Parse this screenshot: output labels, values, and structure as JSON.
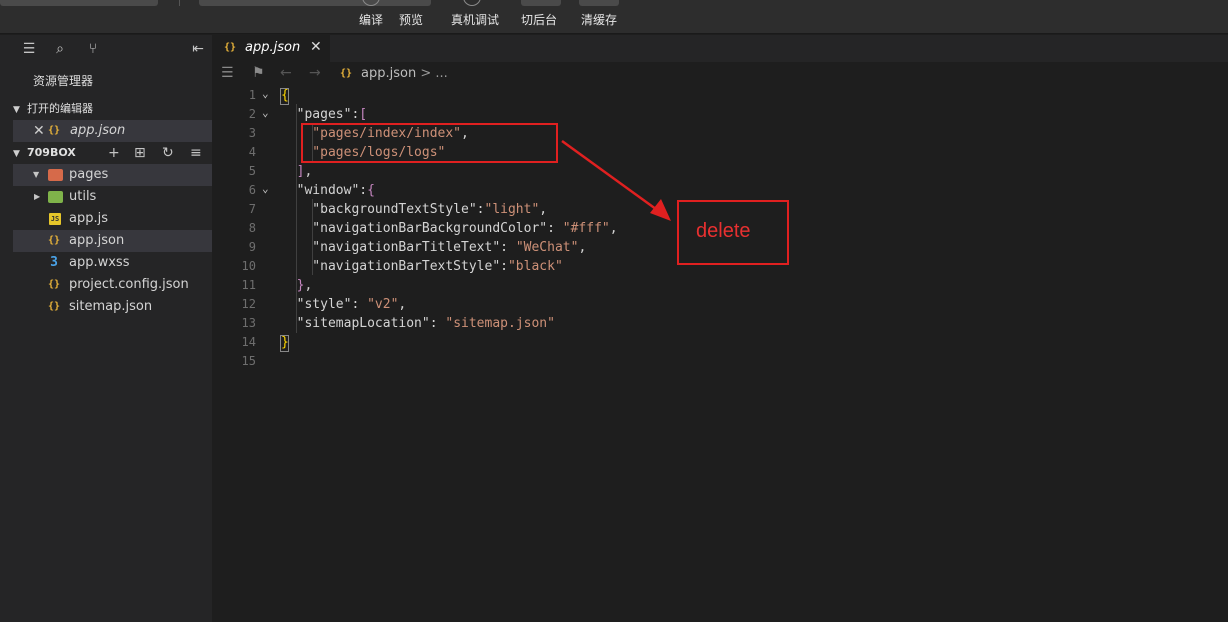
{
  "toolbar": {
    "buttons": [
      {
        "label": "编译"
      },
      {
        "label": "预览"
      },
      {
        "label": "真机调试"
      },
      {
        "label": "切后台"
      },
      {
        "label": "清缓存"
      }
    ]
  },
  "sidebar": {
    "title": "资源管理器",
    "open_editors": {
      "label": "打开的编辑器",
      "items": [
        {
          "name": "app.json"
        }
      ]
    },
    "project": {
      "label": "709BOX",
      "tree": [
        {
          "name": "pages",
          "type": "folder",
          "icon": "folder-pages-icon",
          "color": "#d66a4a"
        },
        {
          "name": "utils",
          "type": "folder",
          "icon": "folder-utils-icon",
          "color": "#7fb34a"
        },
        {
          "name": "app.js",
          "type": "js",
          "icon": "js-file-icon"
        },
        {
          "name": "app.json",
          "type": "json",
          "icon": "json-file-icon"
        },
        {
          "name": "app.wxss",
          "type": "css",
          "icon": "css-file-icon"
        },
        {
          "name": "project.config.json",
          "type": "json",
          "icon": "json-file-icon"
        },
        {
          "name": "sitemap.json",
          "type": "json",
          "icon": "json-file-icon"
        }
      ]
    }
  },
  "editor": {
    "tab": {
      "name": "app.json"
    },
    "breadcrumb": {
      "file": "app.json",
      "rest": "> ..."
    },
    "lines": [
      {
        "n": "1",
        "parts": [
          [
            "b",
            "{"
          ]
        ]
      },
      {
        "n": "2",
        "parts": [
          [
            "k",
            "  \"pages\""
          ],
          [
            "k",
            ":"
          ],
          [
            "p",
            "["
          ]
        ]
      },
      {
        "n": "3",
        "parts": [
          [
            "s",
            "    \"pages/index/index\""
          ],
          [
            "k",
            ","
          ]
        ]
      },
      {
        "n": "4",
        "parts": [
          [
            "s",
            "    \"pages/logs/logs\""
          ]
        ]
      },
      {
        "n": "5",
        "parts": [
          [
            "p",
            "  ]"
          ],
          [
            "k",
            ","
          ]
        ]
      },
      {
        "n": "6",
        "parts": [
          [
            "k",
            "  \"window\""
          ],
          [
            "k",
            ":"
          ],
          [
            "p",
            "{"
          ]
        ]
      },
      {
        "n": "7",
        "parts": [
          [
            "k",
            "    \"backgroundTextStyle\""
          ],
          [
            "k",
            ":"
          ],
          [
            "s",
            "\"light\""
          ],
          [
            "k",
            ","
          ]
        ]
      },
      {
        "n": "8",
        "parts": [
          [
            "k",
            "    \"navigationBarBackgroundColor\""
          ],
          [
            "k",
            ": "
          ],
          [
            "s",
            "\"#fff\""
          ],
          [
            "k",
            ","
          ]
        ]
      },
      {
        "n": "9",
        "parts": [
          [
            "k",
            "    \"navigationBarTitleText\""
          ],
          [
            "k",
            ": "
          ],
          [
            "s",
            "\"WeChat\""
          ],
          [
            "k",
            ","
          ]
        ]
      },
      {
        "n": "10",
        "parts": [
          [
            "k",
            "    \"navigationBarTextStyle\""
          ],
          [
            "k",
            ":"
          ],
          [
            "s",
            "\"black\""
          ]
        ]
      },
      {
        "n": "11",
        "parts": [
          [
            "p",
            "  }"
          ],
          [
            "k",
            ","
          ]
        ]
      },
      {
        "n": "12",
        "parts": [
          [
            "k",
            "  \"style\""
          ],
          [
            "k",
            ": "
          ],
          [
            "s",
            "\"v2\""
          ],
          [
            "k",
            ","
          ]
        ]
      },
      {
        "n": "13",
        "parts": [
          [
            "k",
            "  \"sitemapLocation\""
          ],
          [
            "k",
            ": "
          ],
          [
            "s",
            "\"sitemap.json\""
          ]
        ]
      },
      {
        "n": "14",
        "parts": [
          [
            "b",
            "}"
          ]
        ]
      },
      {
        "n": "15",
        "parts": []
      }
    ]
  },
  "annotation": {
    "text": "delete",
    "color": "#e02020"
  }
}
